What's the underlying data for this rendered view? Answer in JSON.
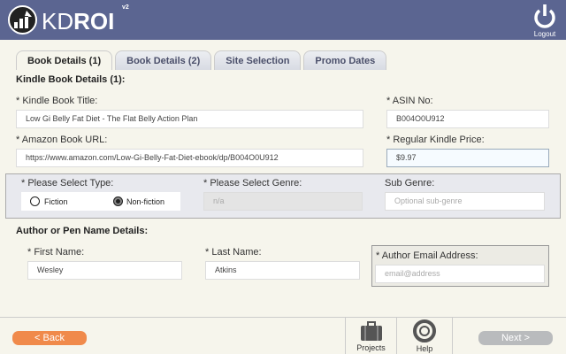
{
  "header": {
    "logo_light": "KD",
    "logo_bold": "ROI",
    "version": "v2",
    "logout": "Logout"
  },
  "tabs": [
    "Book Details (1)",
    "Book Details (2)",
    "Site Selection",
    "Promo Dates"
  ],
  "section1": {
    "title": "Kindle Book Details (1):",
    "title_label": "* Kindle Book Title:",
    "title_value": "Low Gi Belly Fat Diet - The Flat Belly Action Plan",
    "asin_label": "* ASIN No:",
    "asin_value": "B004O0U912",
    "url_label": "* Amazon Book URL:",
    "url_value": "https://www.amazon.com/Low-Gi-Belly-Fat-Diet-ebook/dp/B004O0U912",
    "price_label": "* Regular Kindle Price:",
    "price_value": "$9.97",
    "type_label": "* Please Select Type:",
    "fiction": "Fiction",
    "nonfiction": "Non-fiction",
    "selected_type": "Non-fiction",
    "genre_label": "* Please Select Genre:",
    "genre_value": "n/a",
    "subgenre_label": "Sub Genre:",
    "subgenre_placeholder": "Optional sub-genre"
  },
  "section2": {
    "title": "Author or Pen Name Details:",
    "first_label": "* First Name:",
    "first_value": "Wesley",
    "last_label": "* Last Name:",
    "last_value": "Atkins",
    "email_label": "* Author Email Address:",
    "email_placeholder": "email@address"
  },
  "footer": {
    "back": "< Back",
    "projects": "Projects",
    "help": "Help",
    "next": "Next >"
  },
  "colors": {
    "header": "#5b6591",
    "back": "#f08a4b",
    "next": "#b9bbbd"
  }
}
